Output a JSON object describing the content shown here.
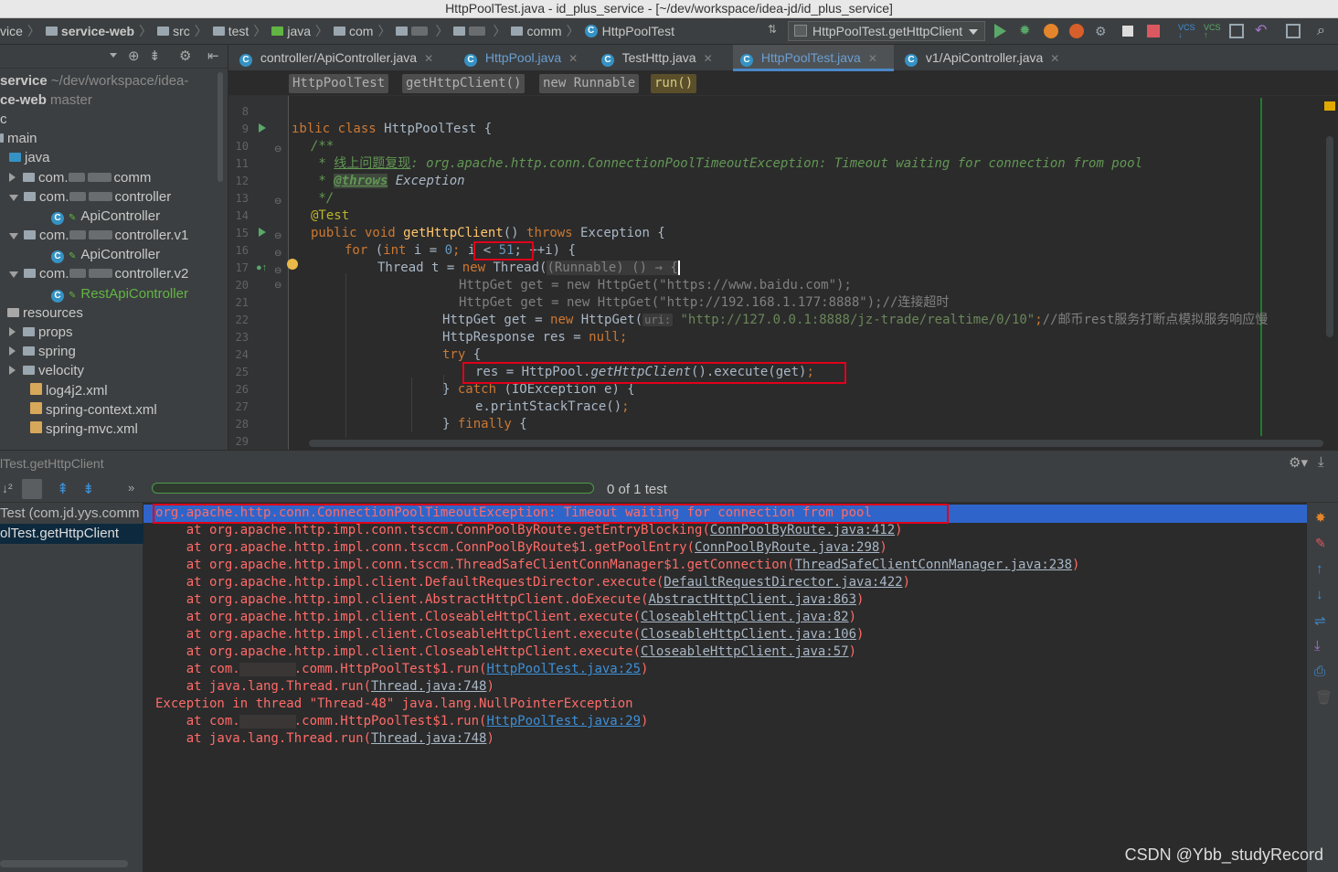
{
  "window": {
    "title": "HttpPoolTest.java - id_plus_service - [~/dev/workspace/idea-jd/id_plus_service]"
  },
  "navbar": {
    "crumbs": [
      "vice",
      "service-web",
      "src",
      "test",
      "java",
      "com",
      "comm",
      "HttpPoolTest"
    ],
    "run_config": "HttpPoolTest.getHttpClient"
  },
  "project": {
    "rows": [
      {
        "text": "service",
        "dim": " ~/dev/workspace/idea-"
      },
      {
        "text": "ce-web",
        "dim": " master"
      },
      {
        "text": "c",
        "dim": ""
      },
      {
        "text": "main",
        "dim": ""
      },
      {
        "text": "java",
        "dim": ""
      },
      {
        "text": "com.",
        "dim": "comm"
      },
      {
        "text": "com.",
        "dim": "controller"
      },
      {
        "text": "ApiController",
        "dim": ""
      },
      {
        "text": "com.",
        "dim": "controller.v1"
      },
      {
        "text": "ApiController",
        "dim": ""
      },
      {
        "text": "com.",
        "dim": "controller.v2"
      },
      {
        "text": "RestApiController",
        "dim": ""
      },
      {
        "text": "resources",
        "dim": ""
      },
      {
        "text": "props",
        "dim": ""
      },
      {
        "text": "spring",
        "dim": ""
      },
      {
        "text": "velocity",
        "dim": ""
      },
      {
        "text": "log4j2.xml",
        "dim": ""
      },
      {
        "text": "spring-context.xml",
        "dim": ""
      },
      {
        "text": "spring-mvc.xml",
        "dim": ""
      }
    ]
  },
  "tabs": [
    {
      "label": "controller/ApiController.java"
    },
    {
      "label": "HttpPool.java"
    },
    {
      "label": "TestHttp.java"
    },
    {
      "label": "HttpPoolTest.java"
    },
    {
      "label": "v1/ApiController.java"
    }
  ],
  "breadcrumbs": [
    "HttpPoolTest",
    "getHttpClient()",
    "new Runnable",
    "run()"
  ],
  "editor": {
    "line_numbers": [
      "8",
      "9",
      "10",
      "11",
      "12",
      "13",
      "14",
      "15",
      "16",
      "17",
      "20",
      "21",
      "22",
      "23",
      "24",
      "25",
      "26",
      "27",
      "28",
      "29"
    ],
    "code": {
      "l9_a": "ıblic class ",
      "l9_b": "HttpPoolTest {",
      "l10": "/**",
      "l11_a": " * ",
      "l11_b": "线上问题复现",
      "l11_c": ": org.apache.http.conn.ConnectionPoolTimeoutException: Timeout waiting for connection from pool",
      "l12_a": " * ",
      "l12_b": "@throws",
      "l12_c": " Exception",
      "l13": " */",
      "l14": "@Test",
      "l15_a": "public void ",
      "l15_b": "getHttpClient",
      "l15_c": "() ",
      "l15_d": "throws",
      "l15_e": " Exception {",
      "l16_a": "for ",
      "l16_b": "(",
      "l16_c": "int ",
      "l16_d": "i = ",
      "l16_e": "0",
      "l16_f": "; ",
      "l16_g": "i < ",
      "l16_h": "51",
      "l16_i": "; ++i) {",
      "l17_a": "Thread t = ",
      "l17_b": "new ",
      "l17_c": "Thread(",
      "l17_d": "(Runnable) () → {",
      "l20": "HttpGet get = new HttpGet(\"https://www.baidu.com\");",
      "l21": "HttpGet get = new HttpGet(\"http://192.168.1.177:8888\");//连接超时",
      "l22_a": "HttpGet get = ",
      "l22_b": "new ",
      "l22_c": "HttpGet(",
      "l22_hint": "uri:",
      "l22_d": " \"http://127.0.0.1:8888/jz-trade/realtime/0/10\"",
      "l22_e": ";",
      "l22_f": "//邮币rest服务打断点模拟服务响应慢",
      "l23_a": "HttpResponse res = ",
      "l23_b": "null",
      "l23_c": ";",
      "l24_a": "try ",
      "l24_b": "{",
      "l25_a": "res = HttpPool.",
      "l25_b": "getHttpClient",
      "l25_c": "().execute(get)",
      "l25_d": ";",
      "l26_a": "} ",
      "l26_b": "catch ",
      "l26_c": "(IOException e) {",
      "l27_a": "e.printStackTrace()",
      "l27_b": ";",
      "l28_a": "} ",
      "l28_b": "finally ",
      "l28_c": "{"
    }
  },
  "run": {
    "title": "lTest.getHttpClient",
    "progress_label": "0 of 1 test",
    "tree": [
      "Test (com.jd.yys.comm",
      "olTest.getHttpClient"
    ],
    "console": {
      "exception": "org.apache.http.conn.ConnectionPoolTimeoutException: Timeout waiting for connection from pool",
      "frames": [
        {
          "text": "    at org.apache.http.impl.conn.tsccm.ConnPoolByRoute.getEntryBlocking(",
          "link": "ConnPoolByRoute.java:412",
          "end": ")"
        },
        {
          "text": "    at org.apache.http.impl.conn.tsccm.ConnPoolByRoute$1.getPoolEntry(",
          "link": "ConnPoolByRoute.java:298",
          "end": ")"
        },
        {
          "text": "    at org.apache.http.impl.conn.tsccm.ThreadSafeClientConnManager$1.getConnection(",
          "link": "ThreadSafeClientConnManager.java:238",
          "end": ")"
        },
        {
          "text": "    at org.apache.http.impl.client.DefaultRequestDirector.execute(",
          "link": "DefaultRequestDirector.java:422",
          "end": ")"
        },
        {
          "text": "    at org.apache.http.impl.client.AbstractHttpClient.doExecute(",
          "link": "AbstractHttpClient.java:863",
          "end": ")"
        },
        {
          "text": "    at org.apache.http.impl.client.CloseableHttpClient.execute(",
          "link": "CloseableHttpClient.java:82",
          "end": ")"
        },
        {
          "text": "    at org.apache.http.impl.client.CloseableHttpClient.execute(",
          "link": "CloseableHttpClient.java:106",
          "end": ")"
        },
        {
          "text": "    at org.apache.http.impl.client.CloseableHttpClient.execute(",
          "link": "CloseableHttpClient.java:57",
          "end": ")"
        },
        {
          "text": "    at com.       .comm.HttpPoolTest$1.run(",
          "link": "HttpPoolTest.java:25",
          "end": ")",
          "blue": true
        },
        {
          "text": "    at java.lang.Thread.run(",
          "link": "Thread.java:748",
          "end": ")"
        }
      ],
      "npe": "Exception in thread \"Thread-48\" java.lang.NullPointerException",
      "frames2": [
        {
          "text": "    at com.       .comm.HttpPoolTest$1.run(",
          "link": "HttpPoolTest.java:29",
          "end": ")",
          "blue": true
        },
        {
          "text": "    at java.lang.Thread.run(",
          "link": "Thread.java:748",
          "end": ")"
        }
      ]
    }
  },
  "watermark": "CSDN @Ybb_studyRecord",
  "colors": {
    "error": "#ff6b68",
    "highlight_box": "#e0001a",
    "selection": "#2f65ca",
    "accent_tab": "#4a88c7"
  }
}
